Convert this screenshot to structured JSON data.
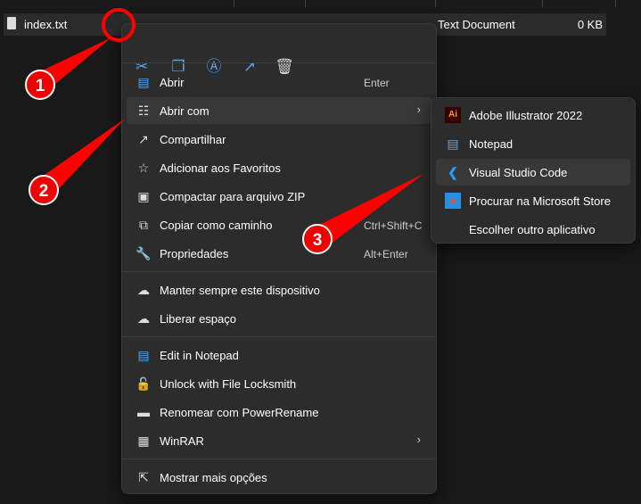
{
  "file": {
    "name": "index.txt",
    "type": "Text Document",
    "size": "0 KB"
  },
  "toolbar": [
    {
      "icon": "cut-icon"
    },
    {
      "icon": "copy-icon"
    },
    {
      "icon": "rename-icon"
    },
    {
      "icon": "share-icon"
    },
    {
      "icon": "delete-icon"
    }
  ],
  "menu": [
    {
      "label": "Abrir",
      "shortcut": "Enter",
      "icon": "notepad-icon"
    },
    {
      "label": "Abrir com",
      "submenu": true,
      "icon": "open-with-icon"
    },
    {
      "label": "Compartilhar",
      "icon": "share-icon"
    },
    {
      "label": "Adicionar aos Favoritos",
      "icon": "star-icon"
    },
    {
      "label": "Compactar para arquivo ZIP",
      "icon": "zip-icon"
    },
    {
      "label": "Copiar como caminho",
      "shortcut": "Ctrl+Shift+C",
      "icon": "path-icon"
    },
    {
      "label": "Propriedades",
      "shortcut": "Alt+Enter",
      "icon": "wrench-icon"
    },
    {
      "label": "Manter sempre este dispositivo",
      "icon": "cloud-keep-icon"
    },
    {
      "label": "Liberar espaço",
      "icon": "cloud-icon"
    },
    {
      "label": "Edit in Notepad",
      "icon": "notepad-icon"
    },
    {
      "label": "Unlock with File Locksmith",
      "icon": "lock-icon"
    },
    {
      "label": "Renomear com PowerRename",
      "icon": "powerrename-icon"
    },
    {
      "label": "WinRAR",
      "submenu": true,
      "icon": "winrar-icon"
    },
    {
      "label": "Mostrar mais opções",
      "icon": "more-options-icon"
    }
  ],
  "submenu": [
    {
      "label": "Adobe Illustrator 2022",
      "icon": "illustrator-icon",
      "icon_text": "Ai"
    },
    {
      "label": "Notepad",
      "icon": "notepad-icon"
    },
    {
      "label": "Visual Studio Code",
      "icon": "vscode-icon"
    },
    {
      "label": "Procurar na Microsoft Store",
      "icon": "store-icon"
    },
    {
      "label": "Escolher outro aplicativo"
    }
  ],
  "annotations": [
    "1",
    "2",
    "3"
  ],
  "colors": {
    "annotation": "#ff0000",
    "accent": "#5aa7e6"
  }
}
